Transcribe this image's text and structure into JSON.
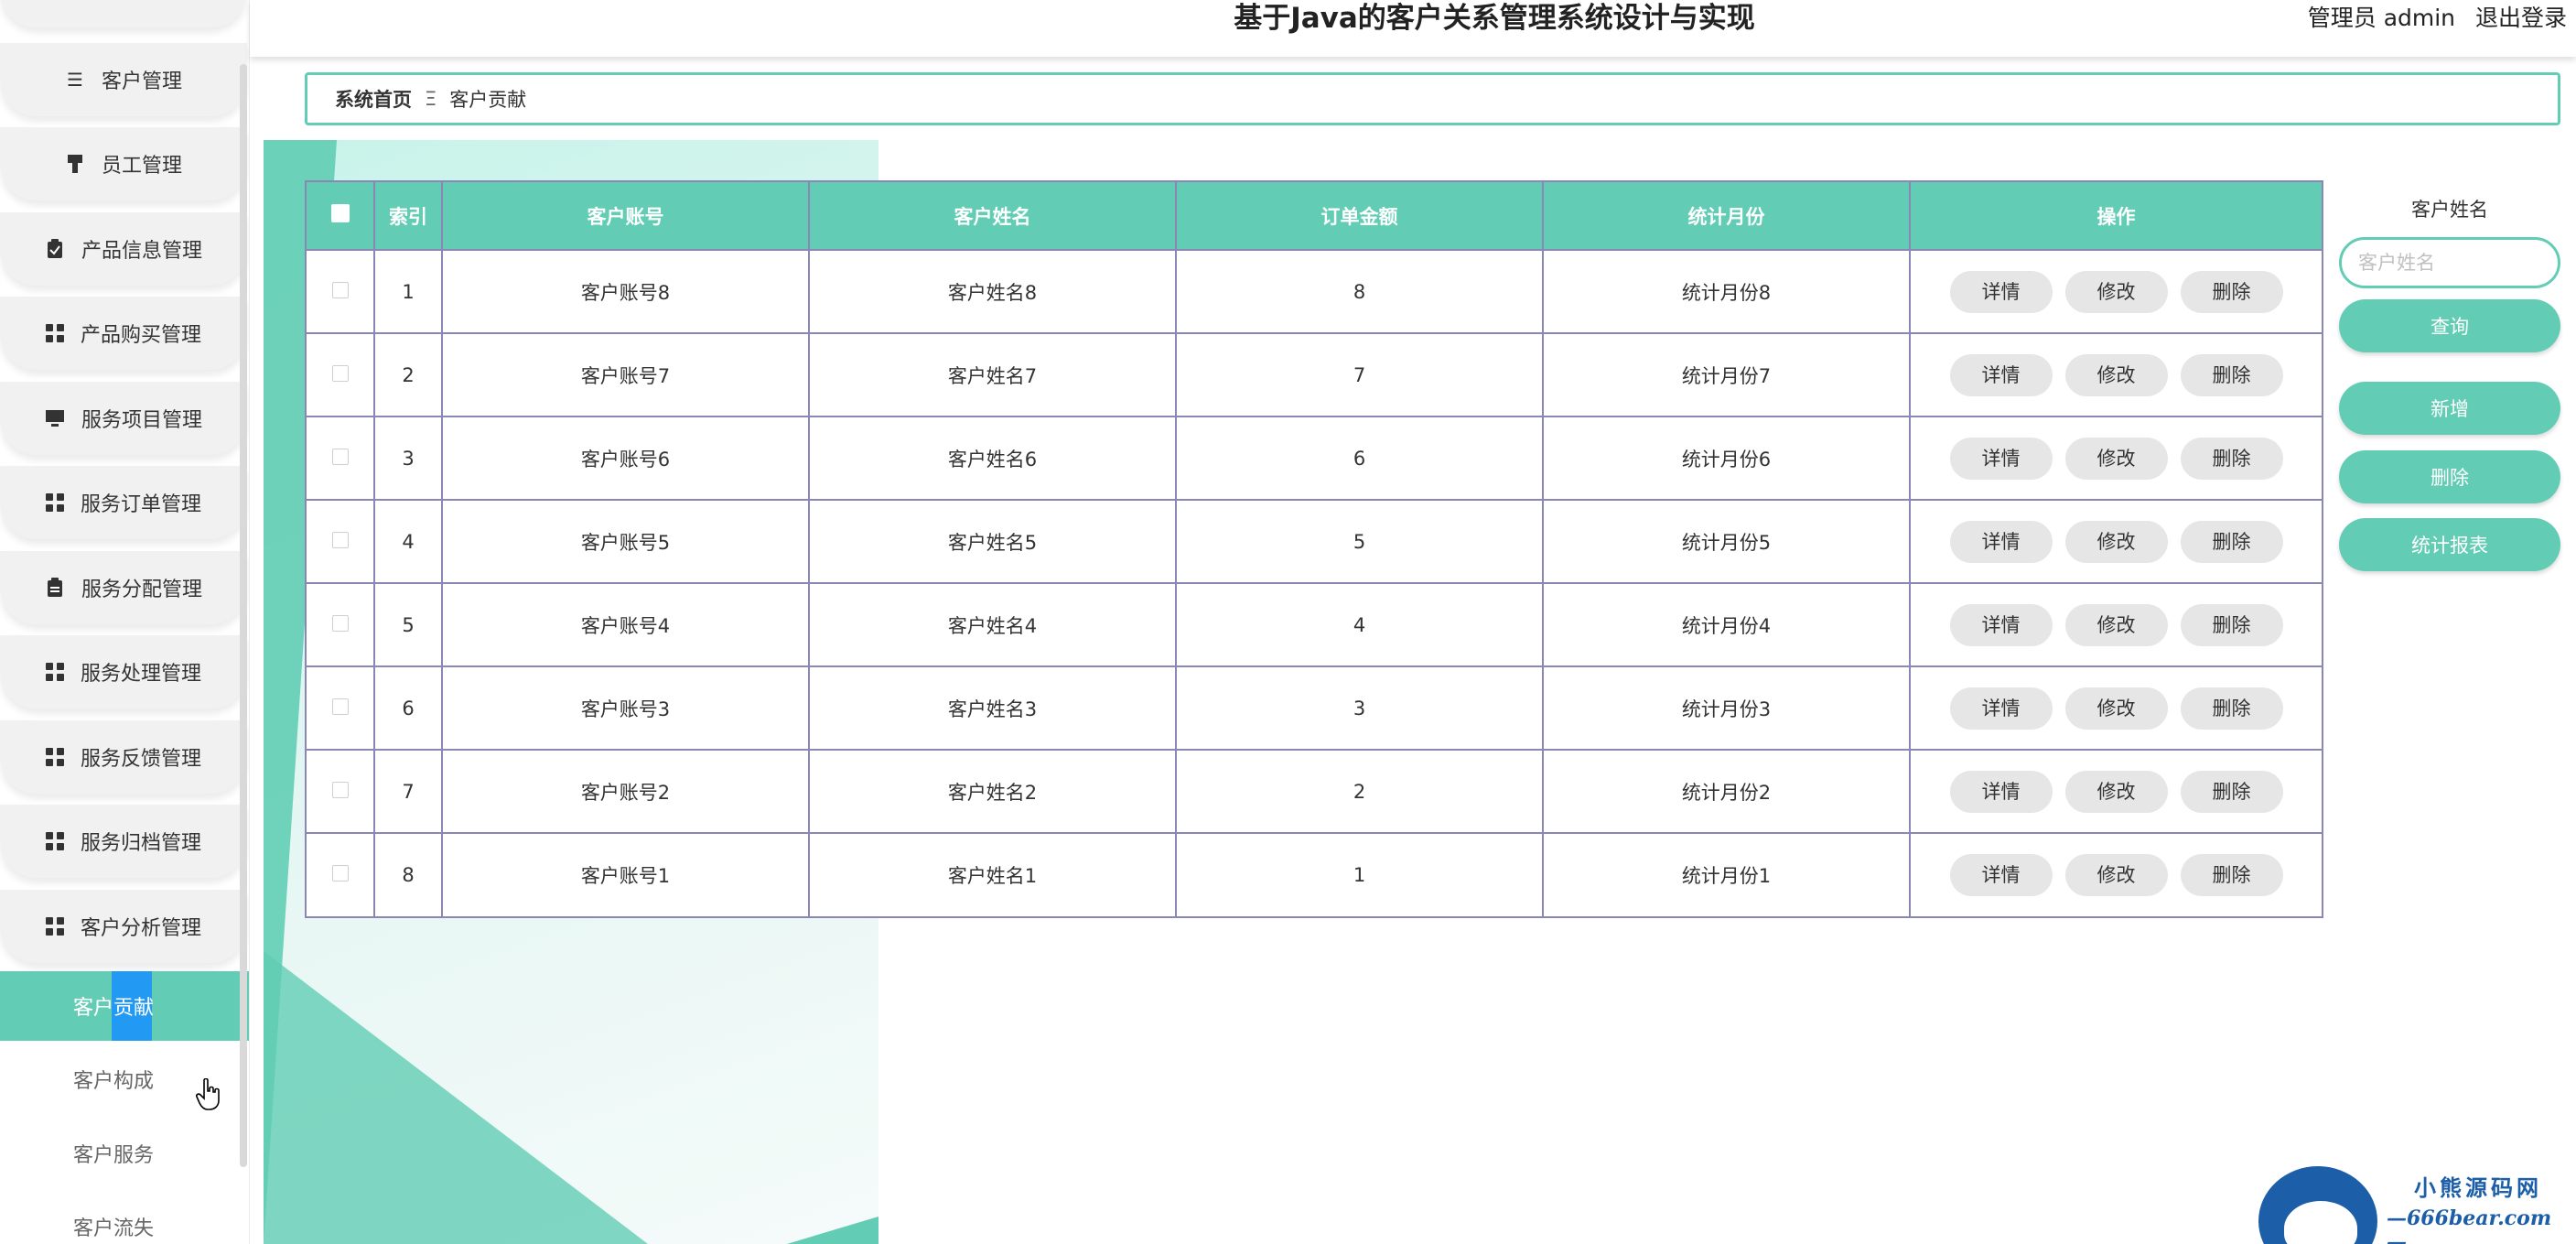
{
  "header": {
    "title": "基于Java的客户关系管理系统设计与实现",
    "user_label": "管理员 admin",
    "logout_label": "退出登录"
  },
  "sidebar": {
    "items": [
      {
        "label": "客户管理",
        "icon": "list-icon"
      },
      {
        "label": "员工管理",
        "icon": "brush-icon"
      },
      {
        "label": "产品信息管理",
        "icon": "clipboard-check-icon"
      },
      {
        "label": "产品购买管理",
        "icon": "grid-icon"
      },
      {
        "label": "服务项目管理",
        "icon": "monitor-icon"
      },
      {
        "label": "服务订单管理",
        "icon": "grid-icon"
      },
      {
        "label": "服务分配管理",
        "icon": "clipboard-icon"
      },
      {
        "label": "服务处理管理",
        "icon": "grid-icon"
      },
      {
        "label": "服务反馈管理",
        "icon": "grid-icon"
      },
      {
        "label": "服务归档管理",
        "icon": "grid-icon"
      },
      {
        "label": "客户分析管理",
        "icon": "grid-icon"
      }
    ],
    "sub_items": [
      {
        "label": "客户贡献",
        "active": true
      },
      {
        "label": "客户构成",
        "active": false
      },
      {
        "label": "客户服务",
        "active": false
      },
      {
        "label": "客户流失",
        "active": false
      }
    ]
  },
  "breadcrumb": {
    "home": "系统首页",
    "separator": "Ξ",
    "current": "客户贡献"
  },
  "table": {
    "columns": [
      "索引",
      "客户账号",
      "客户姓名",
      "订单金额",
      "统计月份",
      "操作"
    ],
    "rows": [
      {
        "index": "1",
        "account": "客户账号8",
        "name": "客户姓名8",
        "amount": "8",
        "month": "统计月份8"
      },
      {
        "index": "2",
        "account": "客户账号7",
        "name": "客户姓名7",
        "amount": "7",
        "month": "统计月份7"
      },
      {
        "index": "3",
        "account": "客户账号6",
        "name": "客户姓名6",
        "amount": "6",
        "month": "统计月份6"
      },
      {
        "index": "4",
        "account": "客户账号5",
        "name": "客户姓名5",
        "amount": "5",
        "month": "统计月份5"
      },
      {
        "index": "5",
        "account": "客户账号4",
        "name": "客户姓名4",
        "amount": "4",
        "month": "统计月份4"
      },
      {
        "index": "6",
        "account": "客户账号3",
        "name": "客户姓名3",
        "amount": "3",
        "month": "统计月份3"
      },
      {
        "index": "7",
        "account": "客户账号2",
        "name": "客户姓名2",
        "amount": "2",
        "month": "统计月份2"
      },
      {
        "index": "8",
        "account": "客户账号1",
        "name": "客户姓名1",
        "amount": "1",
        "month": "统计月份1"
      }
    ],
    "row_actions": {
      "detail": "详情",
      "edit": "修改",
      "delete": "删除"
    }
  },
  "search_panel": {
    "label": "客户姓名",
    "placeholder": "客户姓名",
    "value": "",
    "search_button": "查询",
    "add_button": "新增",
    "delete_button": "删除",
    "report_button": "统计报表"
  },
  "watermark": {
    "name": "小熊源码网",
    "url": "—666bear.com—"
  },
  "colors": {
    "accent": "#62cdb4",
    "table_border": "#8a87b5",
    "active_highlight": "#1890ff",
    "button_gray": "#e6e6e6"
  }
}
